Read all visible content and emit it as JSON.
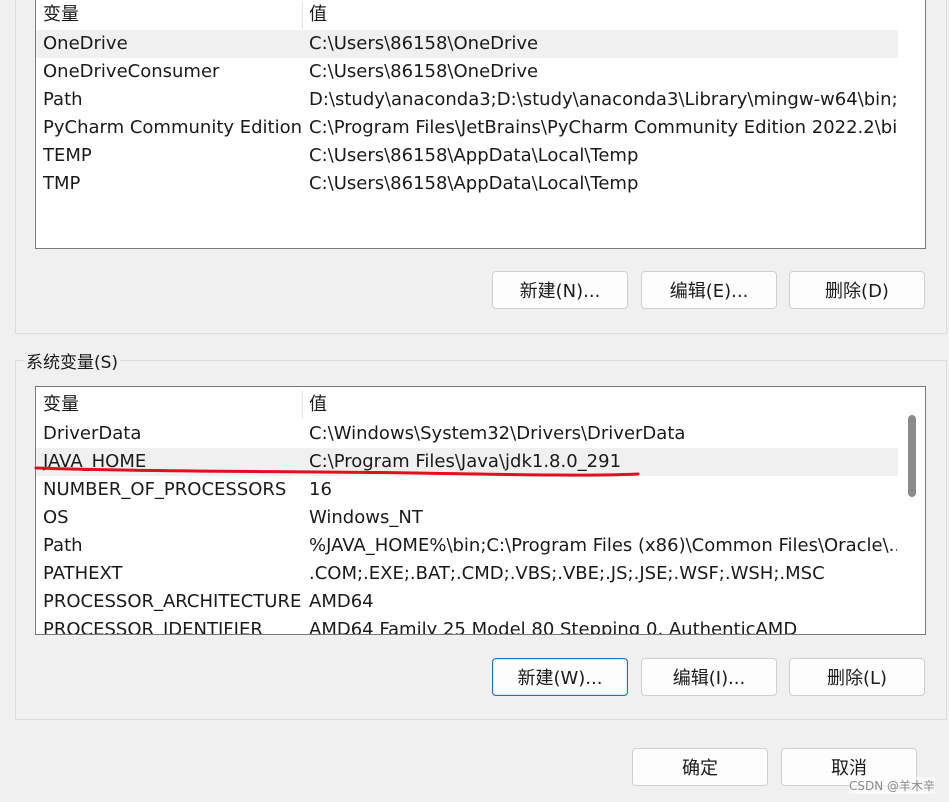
{
  "user_vars": {
    "header": {
      "var": "变量",
      "val": "值"
    },
    "rows": [
      {
        "var": "OneDrive",
        "val": "C:\\Users\\86158\\OneDrive"
      },
      {
        "var": "OneDriveConsumer",
        "val": "C:\\Users\\86158\\OneDrive"
      },
      {
        "var": "Path",
        "val": "D:\\study\\anaconda3;D:\\study\\anaconda3\\Library\\mingw-w64\\bin;..."
      },
      {
        "var": "PyCharm Community Edition",
        "val": "C:\\Program Files\\JetBrains\\PyCharm Community Edition 2022.2\\bi..."
      },
      {
        "var": "TEMP",
        "val": "C:\\Users\\86158\\AppData\\Local\\Temp"
      },
      {
        "var": "TMP",
        "val": "C:\\Users\\86158\\AppData\\Local\\Temp"
      }
    ],
    "buttons": {
      "new": "新建(N)...",
      "edit": "编辑(E)...",
      "delete": "删除(D)"
    }
  },
  "system_vars": {
    "label": "系统变量(S)",
    "header": {
      "var": "变量",
      "val": "值"
    },
    "rows": [
      {
        "var": "DriverData",
        "val": "C:\\Windows\\System32\\Drivers\\DriverData"
      },
      {
        "var": "JAVA_HOME",
        "val": "C:\\Program Files\\Java\\jdk1.8.0_291"
      },
      {
        "var": "NUMBER_OF_PROCESSORS",
        "val": "16"
      },
      {
        "var": "OS",
        "val": "Windows_NT"
      },
      {
        "var": "Path",
        "val": "%JAVA_HOME%\\bin;C:\\Program Files (x86)\\Common Files\\Oracle\\..."
      },
      {
        "var": "PATHEXT",
        "val": ".COM;.EXE;.BAT;.CMD;.VBS;.VBE;.JS;.JSE;.WSF;.WSH;.MSC"
      },
      {
        "var": "PROCESSOR_ARCHITECTURE",
        "val": "AMD64"
      },
      {
        "var": "PROCESSOR_IDENTIFIER",
        "val": "AMD64 Family 25 Model 80 Stepping 0, AuthenticAMD"
      }
    ],
    "buttons": {
      "new": "新建(W)...",
      "edit": "编辑(I)...",
      "delete": "删除(L)"
    }
  },
  "dialog_buttons": {
    "ok": "确定",
    "cancel": "取消"
  },
  "watermark": "CSDN @羊木辛",
  "colors": {
    "highlight_stroke": "#e0101e",
    "default_button_border": "#1f6fbf"
  }
}
